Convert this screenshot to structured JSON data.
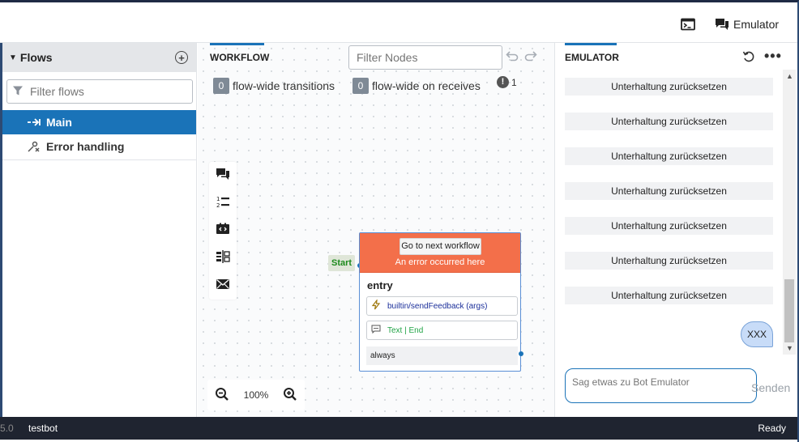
{
  "topbar": {
    "terminal_icon": "terminal-icon",
    "emulator_label": "Emulator"
  },
  "sidebar": {
    "title": "Flows",
    "filter_placeholder": "Filter flows",
    "items": [
      {
        "label": "Main",
        "icon": "flow-arrow-icon",
        "active": true
      },
      {
        "label": "Error handling",
        "icon": "error-flow-icon",
        "active": false
      }
    ]
  },
  "workflow": {
    "title": "WORKFLOW",
    "filter_placeholder": "Filter Nodes",
    "flow_wide_transitions_count": "0",
    "flow_wide_transitions_label": "flow-wide transitions",
    "flow_wide_receives_count": "0",
    "flow_wide_receives_label": "flow-wide on receives",
    "warnings_count": "1",
    "start_label": "Start",
    "node": {
      "error_button": "Go to next workflow",
      "error_message": "An error occurred here",
      "title": "entry",
      "action": "builtin/sendFeedback (args)",
      "say": "Text | End",
      "transition": "always"
    },
    "zoom": "100%",
    "accent_color": "#1a73b8",
    "error_color": "#f36f4a"
  },
  "emulator": {
    "title": "EMULATOR",
    "system_messages": [
      "Unterhaltung zurücksetzen",
      "Unterhaltung zurücksetzen",
      "Unterhaltung zurücksetzen",
      "Unterhaltung zurücksetzen",
      "Unterhaltung zurücksetzen",
      "Unterhaltung zurücksetzen",
      "Unterhaltung zurücksetzen"
    ],
    "user_message": "XXX",
    "input_placeholder": "Sag etwas zu Bot Emulator",
    "send_label": "Senden"
  },
  "statusbar": {
    "version": "5.0",
    "bot_name": "testbot",
    "status": "Ready"
  }
}
